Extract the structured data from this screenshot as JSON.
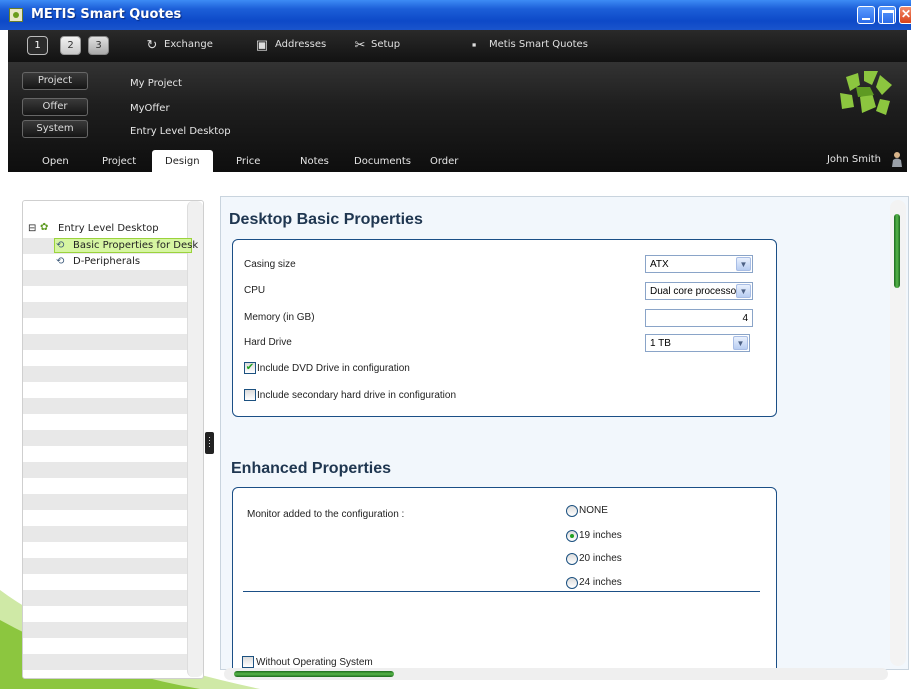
{
  "window": {
    "title": "METIS Smart Quotes"
  },
  "toolbar": {
    "buttons": [
      "1",
      "2",
      "3"
    ],
    "exchange": "Exchange",
    "addresses": "Addresses",
    "setup": "Setup",
    "smart_quotes": "Metis Smart Quotes"
  },
  "header": {
    "project_label": "Project",
    "project_value": "My Project",
    "offer_label": "Offer",
    "offer_value": "MyOffer",
    "system_label": "System",
    "system_value": "Entry Level Desktop",
    "user": "John Smith"
  },
  "tabs": [
    "Open",
    "Project",
    "Design",
    "Price",
    "Notes",
    "Documents",
    "Order"
  ],
  "active_tab": "Design",
  "tree": {
    "root": "Entry Level Desktop",
    "children": [
      "Basic Properties for Desk",
      "D-Peripherals"
    ]
  },
  "basic": {
    "title": "Desktop Basic Properties",
    "casing_label": "Casing size",
    "casing_value": "ATX",
    "cpu_label": "CPU",
    "cpu_value": "Dual core processo",
    "memory_label": "Memory (in GB)",
    "memory_value": "4",
    "hdd_label": "Hard Drive",
    "hdd_value": "1 TB",
    "dvd_label": "Include DVD Drive in configuration",
    "dvd_checked": true,
    "sec_hdd_label": "Include secondary hard drive in configuration",
    "sec_hdd_checked": false
  },
  "enhanced": {
    "title": "Enhanced Properties",
    "monitor_label": "Monitor added to the configuration :",
    "monitor_options": [
      "NONE",
      "19 inches",
      "20 inches",
      "24 inches"
    ],
    "monitor_selected": "19 inches",
    "no_os_label": "Without Operating System"
  },
  "colors": {
    "accent_green": "#8cc63f",
    "dark": "#121212",
    "title_blue": "#0d49c8"
  }
}
